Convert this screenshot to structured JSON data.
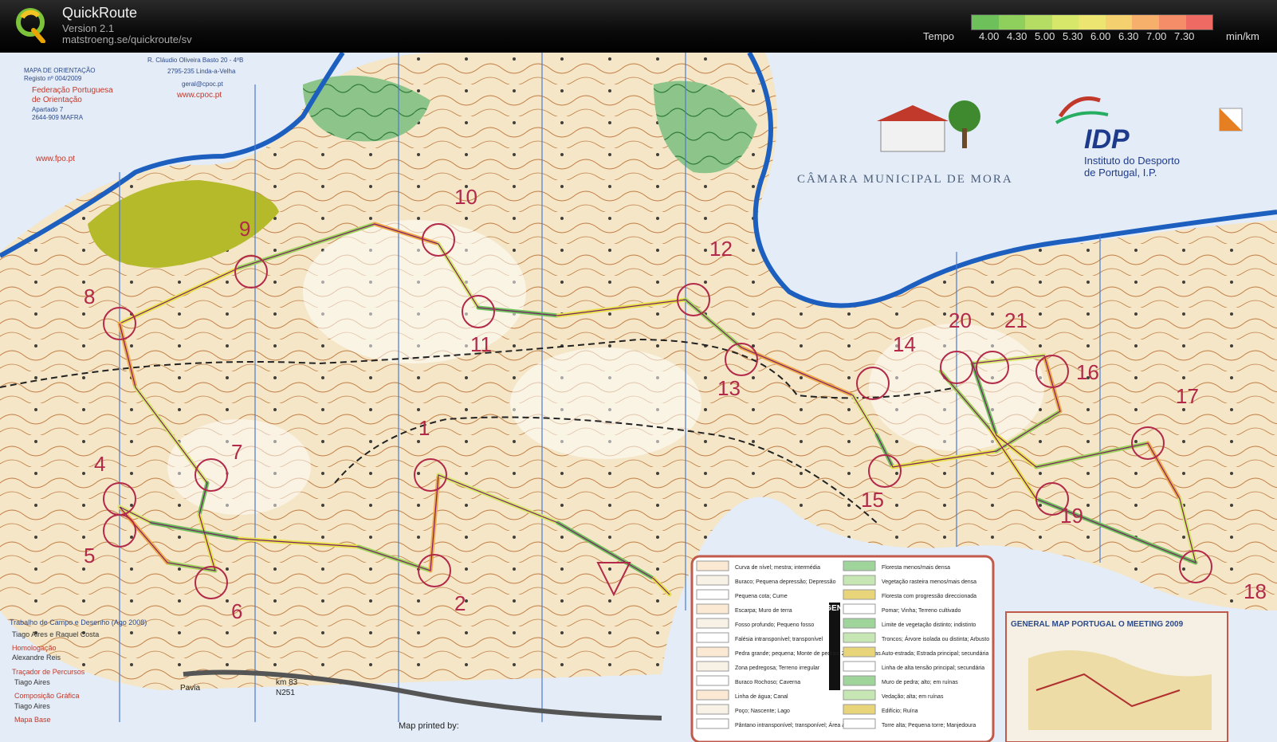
{
  "app": {
    "title": "QuickRoute",
    "version": "Version 2.1",
    "url": "matstroeng.se/quickroute/sv"
  },
  "pace_legend": {
    "label": "Tempo",
    "unit": "min/km",
    "ticks": [
      "4.00",
      "4.30",
      "5.00",
      "5.30",
      "6.00",
      "6.30",
      "7.00",
      "7.30"
    ],
    "colors": [
      "#6ec05a",
      "#8fcf5c",
      "#b5dd63",
      "#d6e76a",
      "#ece572",
      "#f5d06f",
      "#f6b06b",
      "#f48d68",
      "#f06a64"
    ]
  },
  "map": {
    "header_text": "CÂMARA MUNICIPAL DE MORA",
    "org_logo_text": "IDP",
    "org_name_1": "Instituto do Desporto",
    "org_name_2": "de Portugal, I.P.",
    "club_lines": [
      "MAPA DE ORIENTAÇÃO",
      "Registo nº 004/2009",
      "Federação Portuguesa",
      "de Orientação",
      "Apartado 7",
      "2644-909 MAFRA",
      "www.fpo.pt"
    ],
    "address_lines": [
      "R. Cláudio Oliveira Basto 20 - 4ºB",
      "2795-235 Linda-a-Velha",
      "geral@cpoc.pt",
      "www.cpoc.pt"
    ],
    "controls": [
      "1",
      "2",
      "4",
      "5",
      "6",
      "7",
      "8",
      "9",
      "10",
      "11",
      "12",
      "13",
      "14",
      "15",
      "16",
      "17",
      "18",
      "19",
      "20",
      "21"
    ],
    "credits": [
      "Trabalho de Campo e Desenho (Ago 2008)",
      "Tiago Aires e Raquel Costa",
      "Homologação",
      "Alexandre Reis",
      "Traçador de Percursos",
      "Tiago Aires",
      "Composição Gráfica",
      "Tiago Aires",
      "Mapa Base"
    ],
    "place_labels": [
      "Pavia",
      "km 83",
      "N251"
    ],
    "legend_vertical": "LEGENDA",
    "legend_items_left": [
      "Curva de nível; mestra; intermédia",
      "Buraco; Pequena depressão; Depressão",
      "Pequena cota; Cume",
      "Escarpa; Muro de terra",
      "Fosso profundo; Pequeno fosso",
      "Falésia intransponível; transponível",
      "Pedra grande; pequena; Monte de pedras; Zona de pedras",
      "Zona pedregosa; Terreno irregular",
      "Buraco Rochoso; Caverna",
      "Linha de água; Canal",
      "Poço; Nascente; Lago",
      "Pântano intransponível; transponível; Área alagadiça"
    ],
    "legend_items_right": [
      "Floresta menos/mais densa",
      "Vegetação rasteira menos/mais densa",
      "Floresta com progressão direccionada",
      "Pomar; Vinha; Terreno cultivado",
      "Limite de vegetação distinto; indistinto",
      "Troncos; Árvore isolada ou distinta; Arbusto",
      "Auto-estrada; Estrada principal; secundária",
      "Linha de alta tensão principal; secundária",
      "Muro de pedra; alto; em ruínas",
      "Vedação; alta; em ruínas",
      "Edifício; Ruína",
      "Torre alta; Pequena torre; Manjedoura"
    ],
    "general_map_title": "GENERAL MAP PORTUGAL O MEETING 2009",
    "printed_by": "Map printed by:"
  }
}
